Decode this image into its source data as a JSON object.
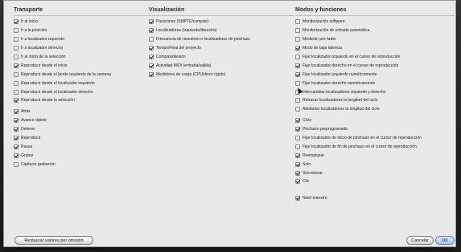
{
  "columns": [
    {
      "title": "Transporte",
      "items": [
        {
          "label": "Ir al inicio",
          "checked": true
        },
        {
          "label": "Ir a la posición",
          "checked": false
        },
        {
          "label": "Ir a localizador izquierdo",
          "checked": false
        },
        {
          "label": "Ir a localizador derecho",
          "checked": false
        },
        {
          "label": "Ir al inicio de la selección",
          "checked": false
        },
        {
          "label": "Reproducir desde el inicio",
          "checked": true
        },
        {
          "label": "Reproducir desde el borde izquierdo de la ventana",
          "checked": false
        },
        {
          "label": "Reproducir desde el localizador izquierdo",
          "checked": false
        },
        {
          "label": "Reproducir desde el localizador derecho",
          "checked": false
        },
        {
          "label": "Reproducir desde la selección",
          "checked": true
        },
        {
          "label": "Atrás",
          "checked": true
        },
        {
          "label": "Avance rápido",
          "checked": true
        },
        {
          "label": "Detener",
          "checked": true
        },
        {
          "label": "Reproducir",
          "checked": true
        },
        {
          "label": "Pausa",
          "checked": true
        },
        {
          "label": "Grabar",
          "checked": true
        },
        {
          "label": "Capturar grabación",
          "checked": false
        }
      ]
    },
    {
      "title": "Visualización",
      "items": [
        {
          "label": "Posiciones (SMPTE/compás)",
          "checked": true
        },
        {
          "label": "Localizadores (izquierdo/derecho)",
          "checked": true
        },
        {
          "label": "Frecuencia de muestreo o localizadores de pinchazo",
          "checked": false
        },
        {
          "label": "Tempo/Final del proyecto",
          "checked": true
        },
        {
          "label": "Compás/división",
          "checked": true
        },
        {
          "label": "Actividad MIDI (entrada/salida)",
          "checked": true
        },
        {
          "label": "Medidores de carga (CPU/disco rígido)",
          "checked": true
        }
      ]
    },
    {
      "title": "Modos y funciones",
      "items": [
        {
          "label": "Monitorización software",
          "checked": false
        },
        {
          "label": "Monitorización de entrada automática",
          "checked": false
        },
        {
          "label": "Medición pre-fader",
          "checked": false
        },
        {
          "label": "Modo de baja latencia",
          "checked": true
        },
        {
          "label": "Fijar localizador izquierdo en el cursor de reproducción",
          "checked": false
        },
        {
          "label": "Fijar localizador derecho en el cursor de reproducción",
          "checked": true
        },
        {
          "label": "Fijar localizador izquierdo numéricamente",
          "checked": true
        },
        {
          "label": "Fijar localizador derecho numéricamente",
          "checked": false
        },
        {
          "label": "Intercambiar localizadores izquierdo y derecho",
          "checked": false
        },
        {
          "label": "Retrasar localizadores la longitud del ciclo",
          "checked": false
        },
        {
          "label": "Adelantar localizadores la longitud del ciclo",
          "checked": false
        },
        {
          "label": "Ciclo",
          "checked": true
        },
        {
          "label": "Pinchazo preprogramado",
          "checked": true
        },
        {
          "label": "Fijar localizador de inicio de pinchazo en el cursor de reproducción",
          "checked": false
        },
        {
          "label": "Fijar localizador de fin de pinchazo en el cursor de reproducción",
          "checked": false
        },
        {
          "label": "Reemplazar",
          "checked": true
        },
        {
          "label": "Solo",
          "checked": true
        },
        {
          "label": "Sincronizar",
          "checked": true
        },
        {
          "label": "Clic",
          "checked": true
        },
        {
          "label": "Nivel maestro",
          "checked": true
        }
      ]
    }
  ],
  "buttons": {
    "restore": "Restaurar valores por omisión",
    "cancel": "Cancelar",
    "ok": "OK"
  }
}
